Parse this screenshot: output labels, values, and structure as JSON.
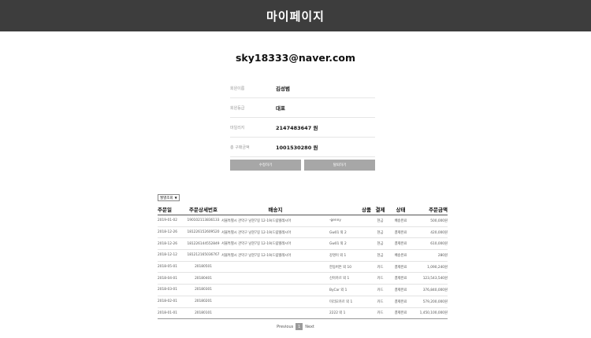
{
  "header": {
    "title": "마이페이지"
  },
  "profile": {
    "email": "sky18333@naver.com",
    "rows": [
      {
        "label": "회원이름",
        "value": "김성범"
      },
      {
        "label": "회원등급",
        "value": "대표"
      },
      {
        "label": "마일리지",
        "value": "2147483647 원"
      },
      {
        "label": "총 구매금액",
        "value": "1001530280 원"
      }
    ],
    "buttons": {
      "edit": "수정하기",
      "withdraw": "탈퇴하기"
    }
  },
  "orders": {
    "sort": {
      "selected": "월별조회"
    },
    "columns": [
      "주문일",
      "주문상세번호",
      "배송지",
      "상품",
      "결제",
      "상태",
      "주문금액"
    ],
    "rows": [
      [
        "2019-01-02",
        "190102113836133",
        "서울특별시 관악구 남현7길 12-19(드림텔레시아",
        "-genny",
        "현금",
        "배송완료",
        "500,000원"
      ],
      [
        "2018-12-26",
        "181226152609520",
        "서울특별시 관악구 남현7길 12-19(드림텔레시아",
        "Gw01 외 2",
        "현금",
        "결제완료",
        "420,000원"
      ],
      [
        "2018-12-26",
        "181226144552849",
        "서울특별시 관악구 남현7길 12-19(드림텔레시아",
        "Gw01 외 2",
        "현금",
        "결제완료",
        "610,000원"
      ],
      [
        "2018-12-12",
        "181212165036767",
        "서울특별시 관악구 남현7길 12-19(드림텔레시아",
        "강명이 외 1",
        "현금",
        "배송완료",
        "280원"
      ],
      [
        "2018-05-01",
        "20180501",
        "",
        "한동버튼 외 10",
        "카드",
        "결제완료",
        "1,090,240원"
      ],
      [
        "2018-04-01",
        "20180401",
        "",
        "신아카르 외 1",
        "카드",
        "결제완료",
        "123,543,540원"
      ],
      [
        "2018-03-01",
        "20180301",
        "",
        "ByCar 외 1",
        "카드",
        "결제완료",
        "376,840,000원"
      ],
      [
        "2018-02-01",
        "20180201",
        "",
        "미리모카르 외 1",
        "카드",
        "결제완료",
        "579,200,000원"
      ],
      [
        "2018-01-01",
        "20180101",
        "",
        "2222 외 1",
        "카드",
        "결제완료",
        "1,450,100,000원"
      ]
    ]
  },
  "pagination": {
    "previous": "Previous",
    "current": "1",
    "next": "Next"
  }
}
